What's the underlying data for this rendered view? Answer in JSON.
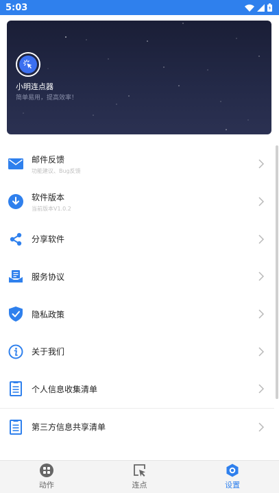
{
  "status_bar": {
    "time": "5:03"
  },
  "colors": {
    "accent": "#2f80ed",
    "header_bg": "#1d2139"
  },
  "header": {
    "app_name": "小明连点器",
    "slogan": "简单易用，提高效率！"
  },
  "menu": {
    "items": [
      {
        "title": "邮件反馈",
        "subtitle": "功能建议、Bug反馈",
        "icon": "mail-icon"
      },
      {
        "title": "软件版本",
        "subtitle": "当前版本V1.0.2",
        "icon": "download-icon"
      },
      {
        "title": "分享软件",
        "subtitle": "",
        "icon": "share-icon"
      },
      {
        "title": "服务协议",
        "subtitle": "",
        "icon": "agreement-icon"
      },
      {
        "title": "隐私政策",
        "subtitle": "",
        "icon": "shield-check-icon"
      },
      {
        "title": "关于我们",
        "subtitle": "",
        "icon": "info-icon"
      },
      {
        "title": "个人信息收集清单",
        "subtitle": "",
        "icon": "list-document-icon"
      },
      {
        "title": "第三方信息共享清单",
        "subtitle": "",
        "icon": "list-document-icon"
      }
    ]
  },
  "bottom_nav": {
    "items": [
      {
        "label": "动作",
        "icon": "grid-icon",
        "active": false
      },
      {
        "label": "连点",
        "icon": "cursor-click-icon",
        "active": false
      },
      {
        "label": "设置",
        "icon": "settings-hexagon-icon",
        "active": true
      }
    ]
  }
}
